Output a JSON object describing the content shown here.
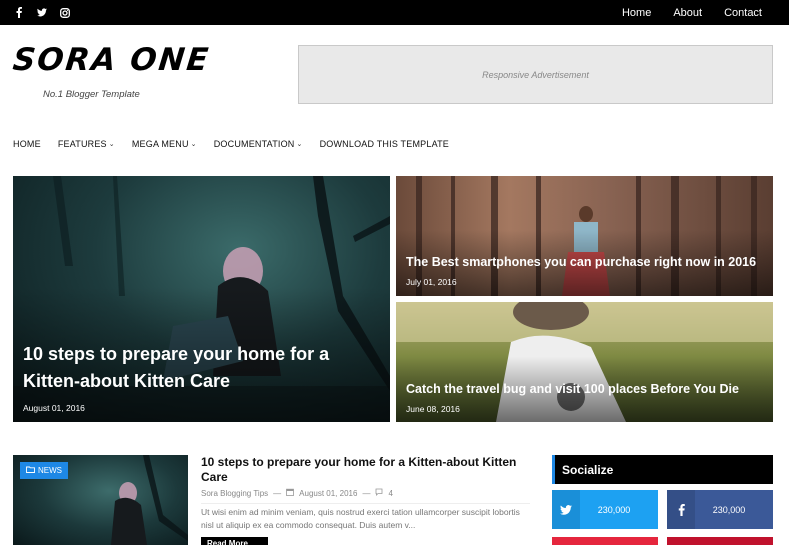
{
  "topbar": {
    "social": [
      {
        "icon": "facebook-icon",
        "glyph": "f"
      },
      {
        "icon": "twitter-icon"
      },
      {
        "icon": "instagram-icon"
      }
    ],
    "links": [
      "Home",
      "About",
      "Contact"
    ]
  },
  "header": {
    "logo": "SORA ONE",
    "tagline": "No.1 Blogger Template",
    "ad_text": "Responsive Advertisement"
  },
  "nav": {
    "items": [
      {
        "label": "HOME",
        "dropdown": false
      },
      {
        "label": "FEATURES",
        "dropdown": true
      },
      {
        "label": "MEGA MENU",
        "dropdown": true
      },
      {
        "label": "DOCUMENTATION",
        "dropdown": true
      },
      {
        "label": "DOWNLOAD THIS TEMPLATE",
        "dropdown": false
      }
    ]
  },
  "featured": [
    {
      "title": "10 steps to prepare your home for a Kitten-about Kitten Care",
      "date": "August 01, 2016"
    },
    {
      "title": "The Best smartphones you can purchase right now in 2016",
      "date": "July 01, 2016"
    },
    {
      "title": "Catch the travel bug and visit 100 places Before You Die",
      "date": "June 08, 2016"
    }
  ],
  "post": {
    "badge": "NEWS",
    "title": "10 steps to prepare your home for a Kitten-about Kitten Care",
    "author": "Sora Blogging Tips",
    "sep": "—",
    "date": "August 01, 2016",
    "comments": "4",
    "excerpt": "Ut wisi enim ad minim veniam, quis nostrud exerci tation ullamcorper suscipit lobortis nisl ut aliquip ex ea commodo consequat. Duis autem v...",
    "read_more": "Read More"
  },
  "sidebar": {
    "widget_title": "Socialize",
    "twitter_count": "230,000",
    "facebook_count": "230,000"
  },
  "colors": {
    "accent": "#1e88e5",
    "twitter": "#1da1f2",
    "facebook": "#3b5998",
    "pinterest": "#e5263d"
  }
}
